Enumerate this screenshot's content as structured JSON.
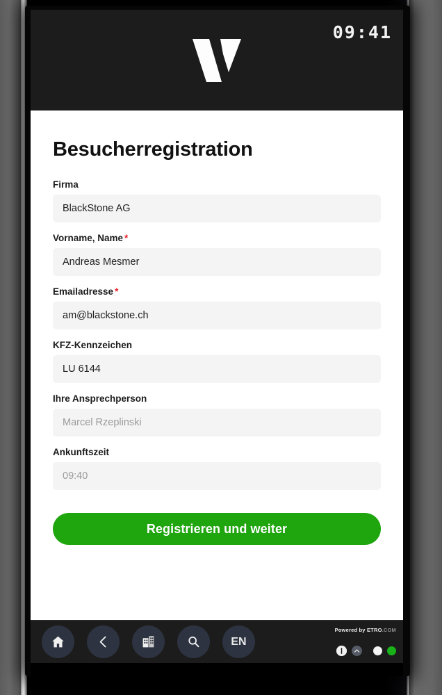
{
  "statusbar": {
    "time": "09:41"
  },
  "logo": {
    "name": "vendoc-v-logo",
    "alt": "V"
  },
  "form": {
    "title": "Besucherregistration",
    "fields": [
      {
        "label": "Firma",
        "required": false,
        "value": "BlackStone AG",
        "is_placeholder": false,
        "name": "company"
      },
      {
        "label": "Vorname, Name",
        "required": true,
        "value": "Andreas Mesmer",
        "is_placeholder": false,
        "name": "full-name"
      },
      {
        "label": "Emailadresse",
        "required": true,
        "value": "am@blackstone.ch",
        "is_placeholder": false,
        "name": "email"
      },
      {
        "label": "KFZ-Kennzeichen",
        "required": false,
        "value": "LU 6144",
        "is_placeholder": false,
        "name": "license-plate"
      },
      {
        "label": "Ihre Ansprechperson",
        "required": false,
        "value": "Marcel Rzeplinski",
        "is_placeholder": true,
        "name": "contact-person"
      },
      {
        "label": "Ankunftszeit",
        "required": false,
        "value": "09:40",
        "is_placeholder": true,
        "name": "arrival-time"
      }
    ],
    "required_marker": "*",
    "submit_label": "Registrieren und weiter"
  },
  "navbar": {
    "buttons": [
      {
        "name": "home-icon",
        "label": ""
      },
      {
        "name": "back-icon",
        "label": ""
      },
      {
        "name": "building-icon",
        "label": ""
      },
      {
        "name": "search-icon",
        "label": ""
      },
      {
        "name": "language-button",
        "label": "EN"
      }
    ],
    "brand_prefix": "Powered by ",
    "brand_name": "ETRO",
    "brand_suffix": ".COM",
    "indicators": [
      {
        "name": "info-badge",
        "type": "badge-info"
      },
      {
        "name": "chevron-up-badge",
        "type": "badge-up"
      },
      {
        "name": "status-dot-white",
        "type": "dot-white"
      },
      {
        "name": "status-dot-green",
        "type": "dot-green"
      }
    ]
  },
  "colors": {
    "accent_green": "#1fa50e",
    "header_black": "#1c1c1c",
    "required_red": "#e8202a",
    "input_grey": "#f4f4f4"
  }
}
